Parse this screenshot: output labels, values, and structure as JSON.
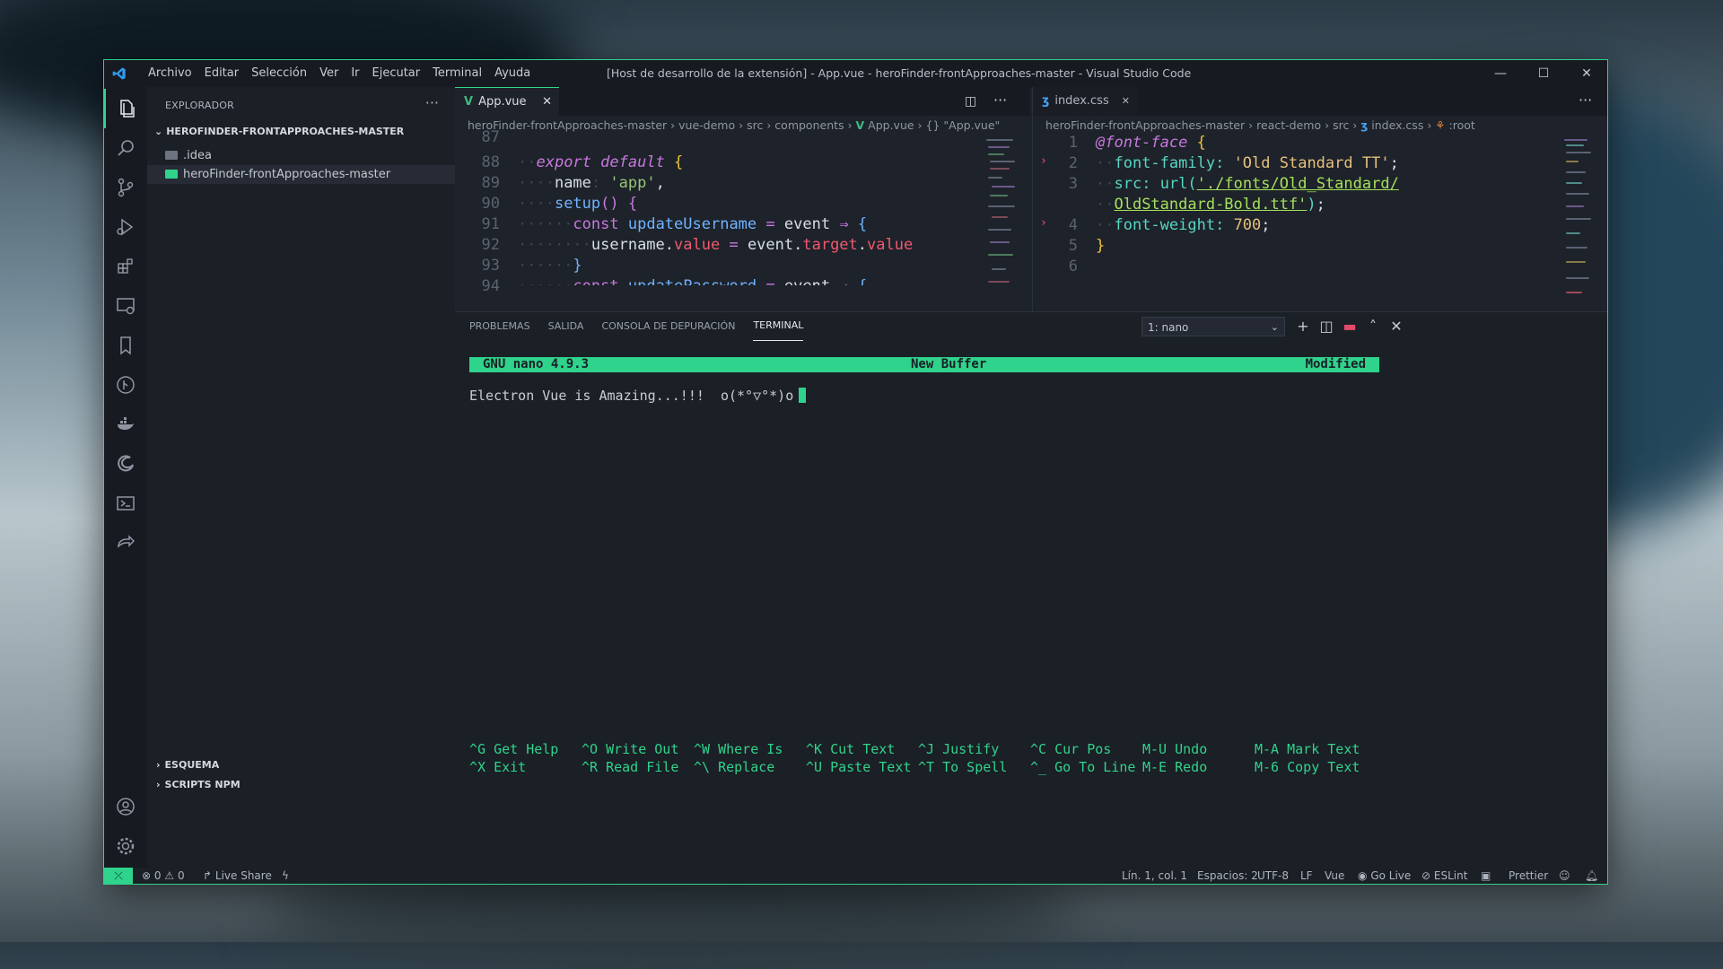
{
  "window": {
    "title": "[Host de desarrollo de la extensión] - App.vue - heroFinder-frontApproaches-master - Visual Studio Code",
    "menu": [
      "Archivo",
      "Editar",
      "Selección",
      "Ver",
      "Ir",
      "Ejecutar",
      "Terminal",
      "Ayuda"
    ],
    "controls": {
      "minimize": "—",
      "maximize": "☐",
      "close": "✕"
    }
  },
  "sidebar": {
    "header": "EXPLORADOR",
    "more": "···",
    "root": "HEROFINDER-FRONTAPPROACHES-MASTER",
    "items": [
      {
        "label": ".idea",
        "selected": false
      },
      {
        "label": "heroFinder-frontApproaches-master",
        "selected": true
      }
    ],
    "sections": [
      "ESQUEMA",
      "SCRIPTS NPM"
    ]
  },
  "editor_left": {
    "tab": "App.vue",
    "tab_close": "✕",
    "breadcrumb": [
      "heroFinder-frontApproaches-master",
      "vue-demo",
      "src",
      "components",
      "App.vue",
      "{} \"App.vue\""
    ],
    "line_numbers": [
      "87",
      "88",
      "89",
      "90",
      "91",
      "92",
      "93",
      "94"
    ]
  },
  "editor_right": {
    "tab": "index.css",
    "tab_close": "✕",
    "breadcrumb": [
      "heroFinder-frontApproaches-master",
      "react-demo",
      "src",
      "index.css",
      ":root"
    ],
    "line_numbers": [
      "1",
      "2",
      "3",
      "",
      "4",
      "5",
      "6"
    ]
  },
  "panel": {
    "tabs": [
      "PROBLEMAS",
      "SALIDA",
      "CONSOLA DE DEPURACIÓN",
      "TERMINAL"
    ],
    "active_tab": "TERMINAL",
    "terminal_select": "1: nano"
  },
  "nano": {
    "version": "GNU nano 4.9.3",
    "buffer": "New Buffer",
    "state": "Modified",
    "text": "Electron Vue is Amazing...!!!  o(*°▽°*)o",
    "shortcuts": [
      [
        "^G",
        "Get Help"
      ],
      [
        "^O",
        "Write Out"
      ],
      [
        "^W",
        "Where Is"
      ],
      [
        "^K",
        "Cut Text"
      ],
      [
        "^J",
        "Justify"
      ],
      [
        "^C",
        "Cur Pos"
      ],
      [
        "M-U",
        "Undo"
      ],
      [
        "M-A",
        "Mark Text"
      ],
      [
        "^X",
        "Exit"
      ],
      [
        "^R",
        "Read File"
      ],
      [
        "^\\",
        "Replace"
      ],
      [
        "^U",
        "Paste Text"
      ],
      [
        "^T",
        "To Spell"
      ],
      [
        "^_",
        "Go To Line"
      ],
      [
        "M-E",
        "Redo"
      ],
      [
        "M-6",
        "Copy Text"
      ]
    ]
  },
  "status": {
    "errors": "0",
    "warnings": "0",
    "live_share": "Live Share",
    "position": "Lín. 1, col. 1",
    "spaces": "Espacios: 2",
    "encoding": "UTF-8",
    "eol": "LF",
    "language": "Vue",
    "go_live": "Go Live",
    "eslint": "ESLint",
    "prettier": "Prettier"
  },
  "colors": {
    "accent": "#2fd38b",
    "background": "#1e222a"
  }
}
